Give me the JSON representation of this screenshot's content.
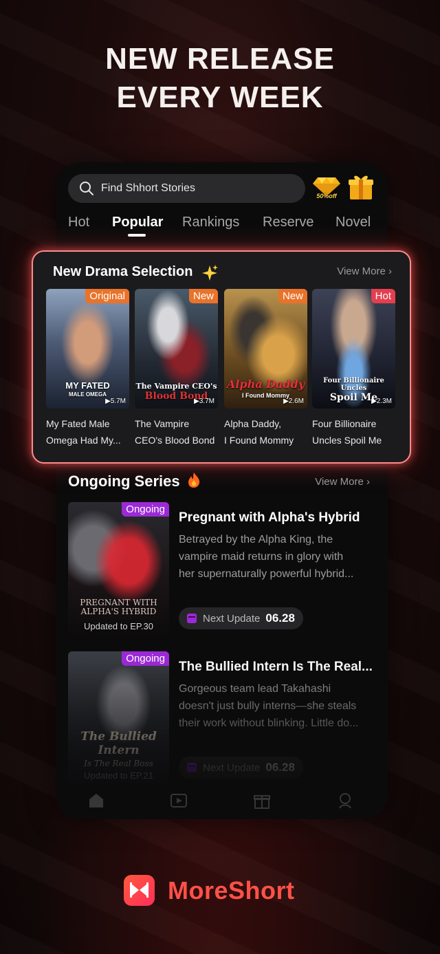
{
  "headline": {
    "line1": "NEW RELEASE",
    "line2": "EVERY WEEK"
  },
  "app": {
    "search_placeholder": "Find Shhort Stories",
    "promo_badge": "50%off",
    "tabs": [
      {
        "label": "Hot"
      },
      {
        "label": "Popular",
        "active": true
      },
      {
        "label": "Rankings"
      },
      {
        "label": "Reserve"
      },
      {
        "label": "Novel"
      }
    ]
  },
  "drama_selection": {
    "title": "New Drama Selection",
    "view_more": "View More",
    "items": [
      {
        "tag": "Original",
        "tag_color": "#e9732a",
        "cover_title": "MY FATED",
        "cover_sub": "MALE OMEGA",
        "views": "5.7M",
        "name_line1": "My Fated Male",
        "name_line2": "Omega Had My..."
      },
      {
        "tag": "New",
        "tag_color": "#e9732a",
        "cover_title": "The Vampire CEO's",
        "cover_sub": "Blood Bond",
        "views": "3.7M",
        "name_line1": "The Vampire",
        "name_line2": "CEO's Blood Bond"
      },
      {
        "tag": "New",
        "tag_color": "#e9732a",
        "cover_title": "Alpha Daddy",
        "cover_sub": "I Found Mommy",
        "views": "2.6M",
        "name_line1": "Alpha Daddy,",
        "name_line2": "I Found Mommy"
      },
      {
        "tag": "Hot",
        "tag_color": "#e43f4e",
        "cover_title": "Four Billionaire Uncles",
        "cover_sub": "Spoil Me",
        "views": "2.3M",
        "name_line1": "Four Billionaire",
        "name_line2": "Uncles Spoil Me"
      }
    ]
  },
  "ongoing": {
    "title": "Ongoing Series",
    "view_more": "View More",
    "items": [
      {
        "tag": "Ongoing",
        "cover_title": "PREGNANT WITH ALPHA'S HYBRID",
        "updated": "Updated to EP.30",
        "title": "Pregnant with Alpha's Hybrid",
        "desc1": "Betrayed by the Alpha King, the",
        "desc2": "vampire maid returns in glory with",
        "desc3": "her supernaturally powerful hybrid...",
        "next_label": "Next Update",
        "next_date": "06.28"
      },
      {
        "tag": "Ongoing",
        "cover_title": "The Bullied Intern",
        "cover_sub": "Is The Real Boss",
        "updated": "Updated to EP.21",
        "title": "The Bullied Intern Is The Real...",
        "desc1": "Gorgeous team lead Takahashi",
        "desc2": "doesn't just bully interns—she steals",
        "desc3": "their work without blinking. Little do...",
        "next_label": "Next Update",
        "next_date": "06.28"
      }
    ]
  },
  "brand": {
    "name": "MoreShort"
  },
  "colors": {
    "accent": "#ff5148",
    "ongoing_tag": "#9b2ad6",
    "card_glow": "#ff8a8a"
  }
}
